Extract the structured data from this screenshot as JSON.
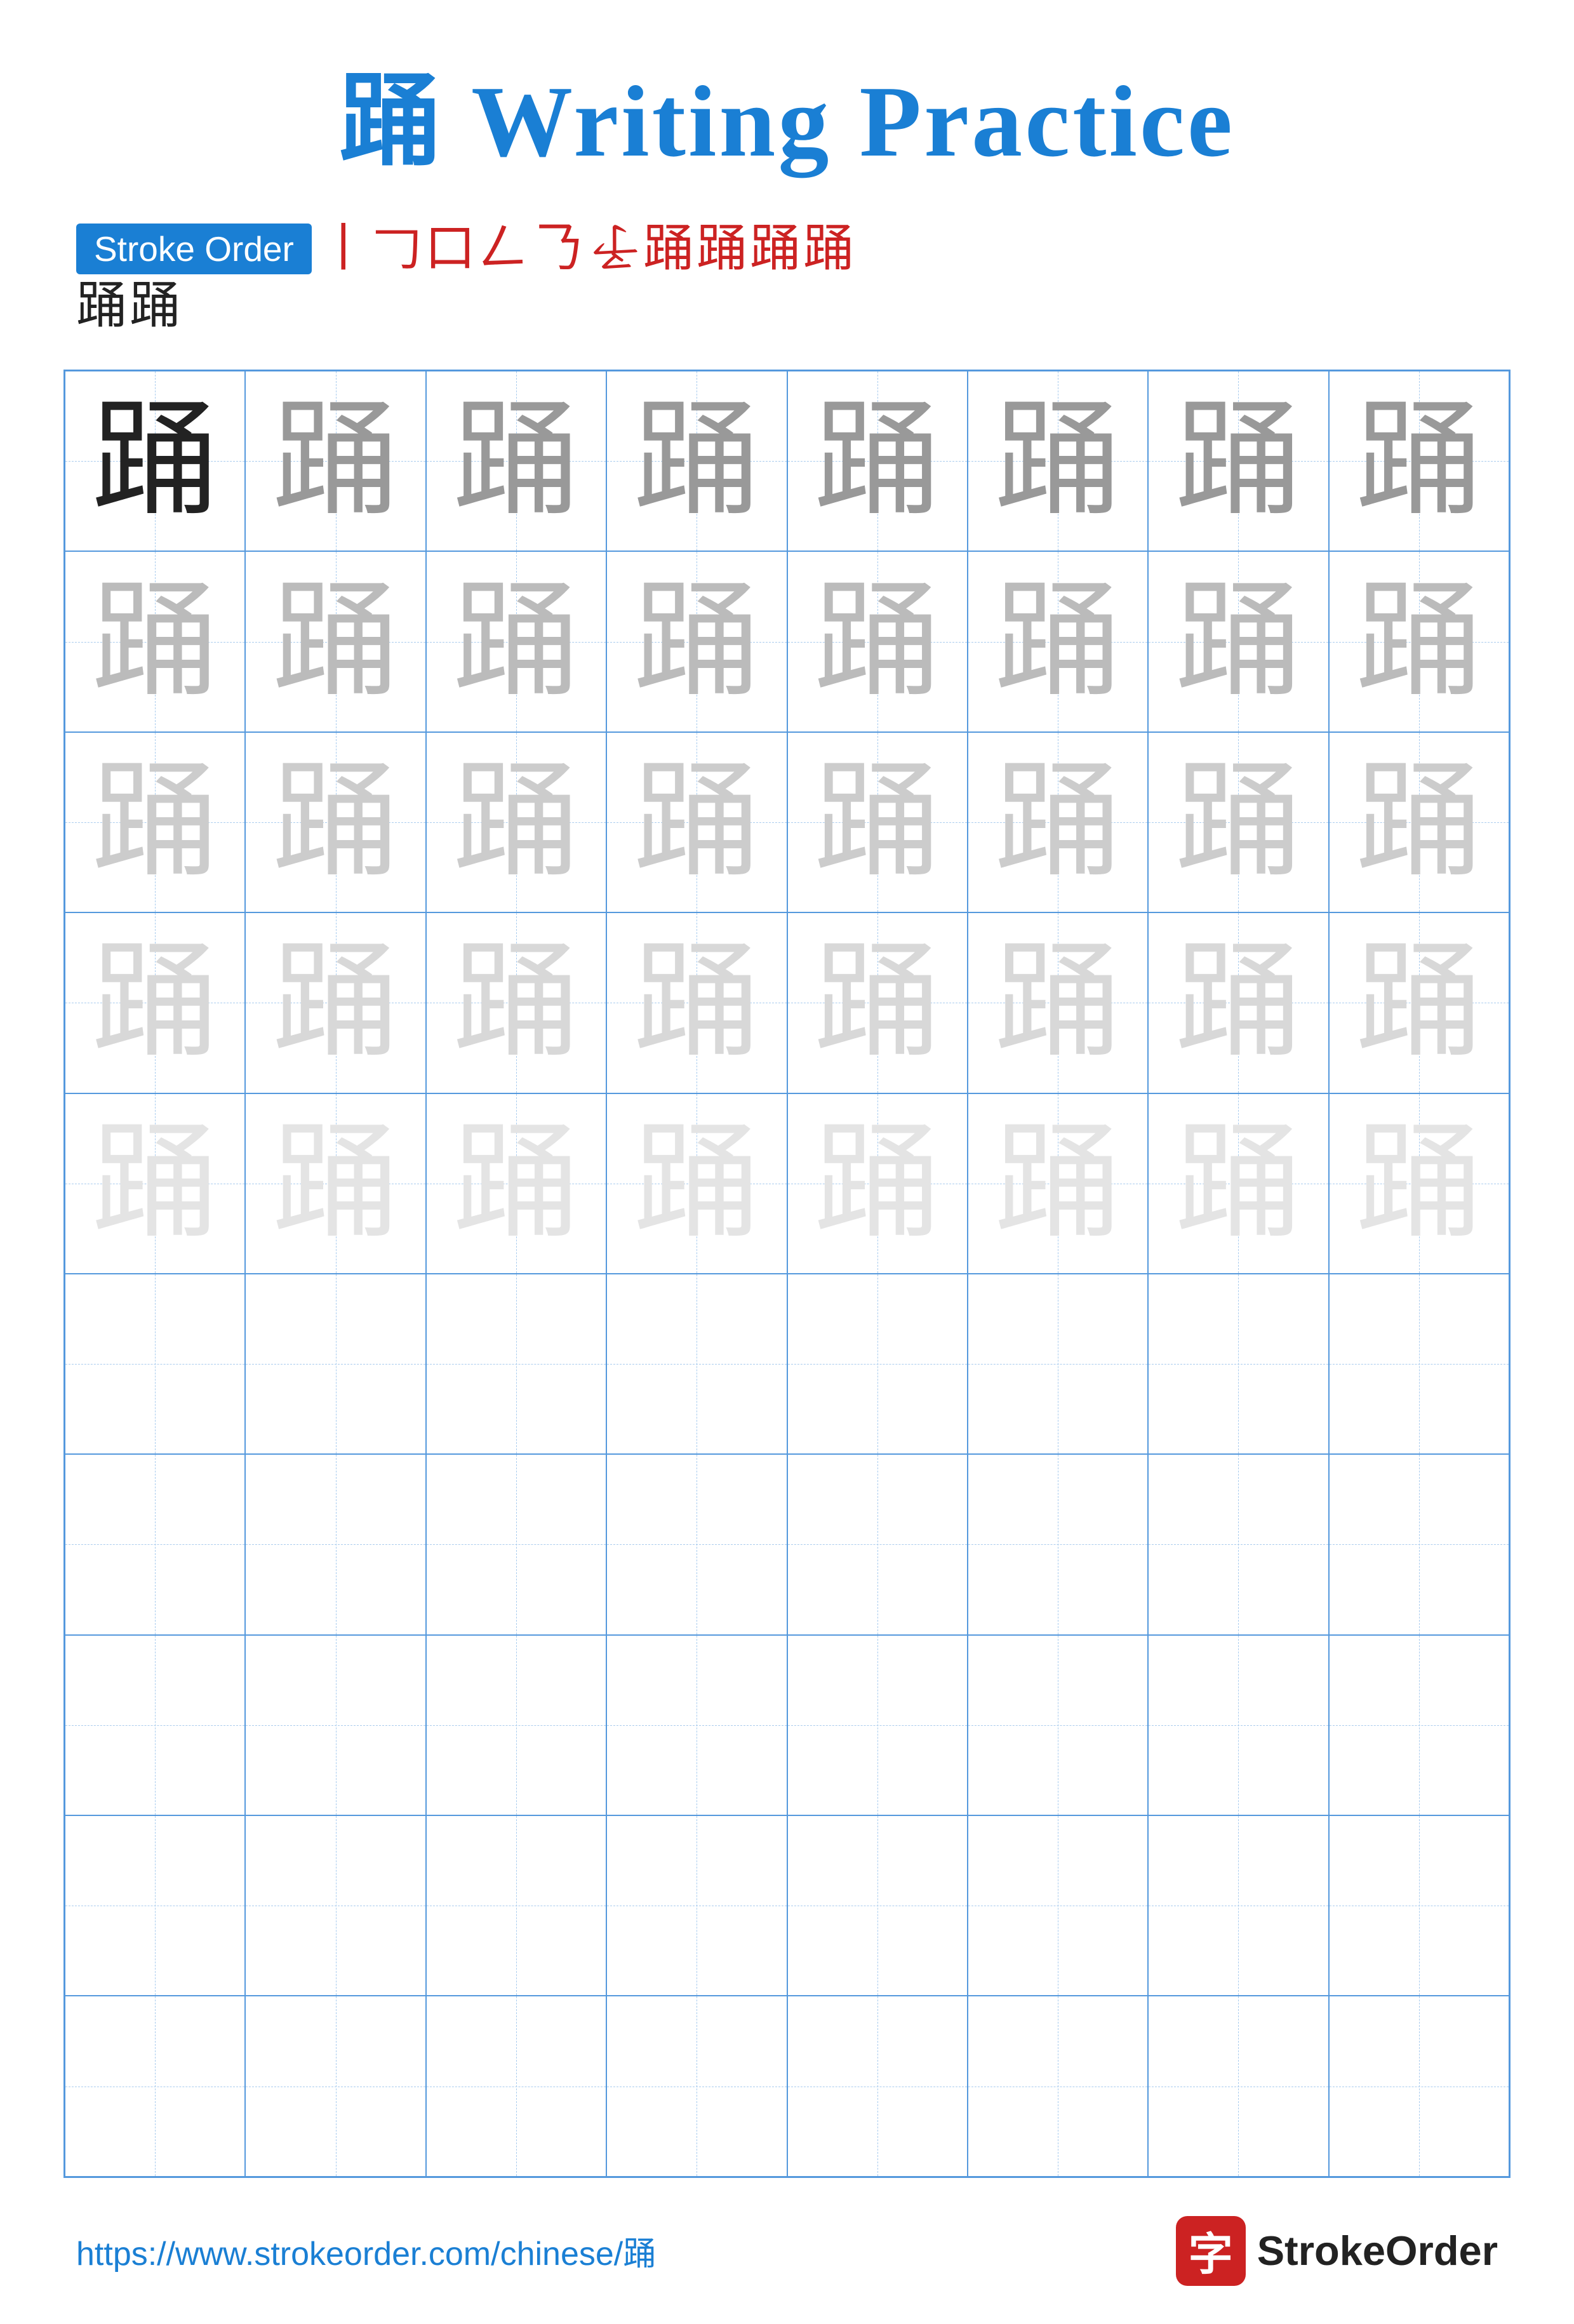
{
  "title": {
    "char": "踊",
    "text": " Writing Practice"
  },
  "stroke_order": {
    "label": "Stroke Order",
    "chars": [
      "丨",
      "𠃌",
      "口",
      "𠃋",
      "𠃎",
      "𠄎",
      "𠄑",
      "𠄔",
      "𠄖",
      "𠄛",
      "踊",
      "踊",
      "踊"
    ]
  },
  "character": "踊",
  "grid": {
    "rows": 10,
    "cols": 8
  },
  "footer": {
    "url": "https://www.strokeorder.com/chinese/踊",
    "brand_char": "字",
    "brand_name": "StrokeOrder"
  }
}
